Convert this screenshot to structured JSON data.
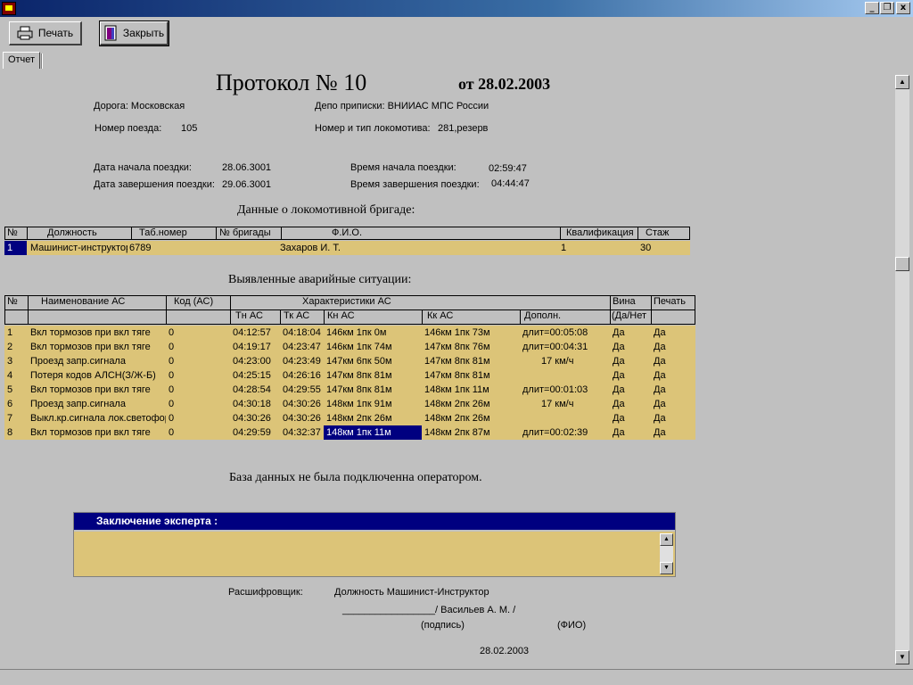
{
  "window": {
    "min_label": "_",
    "restore_label": "❐",
    "close_label": "x"
  },
  "toolbar": {
    "print_label": "Печать",
    "close_label": "Закрыть"
  },
  "tabs": {
    "report_label": "Отчет"
  },
  "header": {
    "title": "Протокол №  10",
    "date": "от 28.02.2003",
    "road": "Дорога: Московская",
    "depot": "Депо приписки: ВНИИАС МПС России",
    "train_label": "Номер поезда:",
    "train_value": "105",
    "loco_label": "Номер и тип локомотива:",
    "loco_value": "281,резерв",
    "start_date_label": "Дата начала поездки:",
    "start_date_value": "28.06.3001",
    "end_date_label": "Дата завершения поездки:",
    "end_date_value": "29.06.3001",
    "start_time_label": "Время начала поездки:",
    "start_time_value": "02:59:47",
    "end_time_label": "Время завершения поездки:",
    "end_time_value": "04:44:47"
  },
  "crew": {
    "section_title": "Данные о локомотивной бригаде:",
    "columns": [
      "№",
      "Должность",
      "Таб.номер",
      "№ бригады",
      "Ф.И.О.",
      "Квалификация",
      "Стаж"
    ],
    "row": [
      "1",
      "Машинист-инструктор",
      "6789",
      "",
      "Захаров И. Т.",
      "1",
      "30"
    ]
  },
  "incidents": {
    "section_title": "Выявленные аварийные ситуации:",
    "top_headers": {
      "num": "№",
      "name": "Наименование АС",
      "code": "Код (АС)",
      "chars": "Характеристики АС",
      "guilt": "Вина",
      "print": "Печать"
    },
    "sub_headers": {
      "tn": "Тн АС",
      "tk": "Тк АС",
      "kn": "Кн АС",
      "kk": "Кк АС",
      "extra": "Дополн.",
      "guilt_sub": "(Да/Нет"
    },
    "rows": [
      [
        "1",
        "Вкл тормозов при вкл тяге",
        "0",
        "04:12:57",
        "04:18:04",
        "146км 1пк 0м",
        "146км 1пк 73м",
        "длит=00:05:08",
        "Да",
        "Да"
      ],
      [
        "2",
        "Вкл тормозов при вкл тяге",
        "0",
        "04:19:17",
        "04:23:47",
        "146км 1пк 74м",
        "147км 8пк 76м",
        "длит=00:04:31",
        "Да",
        "Да"
      ],
      [
        "3",
        "Проезд запр.сигнала",
        "0",
        "04:23:00",
        "04:23:49",
        "147км 6пк 50м",
        "147км 8пк 81м",
        "17 км/ч",
        "Да",
        "Да"
      ],
      [
        "4",
        "Потеря кодов АЛСН(З/Ж-Б)",
        "0",
        "04:25:15",
        "04:26:16",
        "147км 8пк 81м",
        "147км 8пк 81м",
        "",
        "Да",
        "Да"
      ],
      [
        "5",
        "Вкл тормозов при вкл тяге",
        "0",
        "04:28:54",
        "04:29:55",
        "147км 8пк 81м",
        "148км 1пк 11м",
        "длит=00:01:03",
        "Да",
        "Да"
      ],
      [
        "6",
        "Проезд запр.сигнала",
        "0",
        "04:30:18",
        "04:30:26",
        "148км 1пк 91м",
        "148км 2пк 26м",
        "17 км/ч",
        "Да",
        "Да"
      ],
      [
        "7",
        "Выкл.кр.сигнала лок.светофора",
        "0",
        "04:30:26",
        "04:30:26",
        "148км 2пк 26м",
        "148км 2пк 26м",
        "",
        "Да",
        "Да"
      ],
      [
        "8",
        "Вкл тормозов при вкл тяге",
        "0",
        "04:29:59",
        "04:32:37",
        "148км 1пк 11м",
        "148км 2пк 87м",
        "длит=00:02:39",
        "Да",
        "Да"
      ]
    ]
  },
  "db_note": "База данных не была подключенна оператором.",
  "expert": {
    "title": "Заключение эксперта :"
  },
  "footer": {
    "decoder_label": "Расшифровщик:",
    "position": "Должность  Машинист-Инструктор",
    "signature_line": "_________________/ Васильев А. М. /",
    "signature_caption": "(подпись)",
    "fio_caption": "(ФИО)",
    "date": "28.02.2003"
  }
}
